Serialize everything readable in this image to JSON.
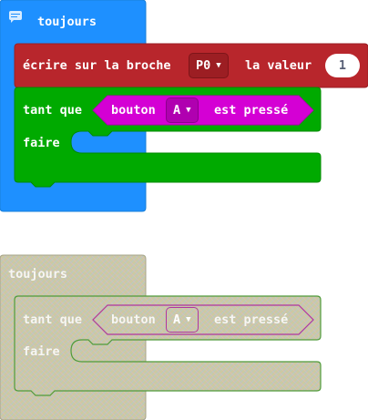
{
  "active_blocks": {
    "forever_label": "toujours",
    "write_pin": {
      "label": "écrire sur la broche",
      "pin": "P0",
      "value_label": "la valeur",
      "value": "1"
    },
    "while": {
      "label": "tant que",
      "condition": {
        "label": "bouton",
        "button": "A",
        "suffix": "est pressé"
      },
      "do_label": "faire"
    }
  },
  "disabled_blocks": {
    "forever_label": "toujours",
    "while": {
      "label": "tant que",
      "condition": {
        "label": "bouton",
        "button": "A",
        "suffix": "est pressé"
      },
      "do_label": "faire"
    }
  },
  "colors": {
    "events_blue": "#1e90ff",
    "pins_red": "#b8262c",
    "loops_green": "#00aa00",
    "input_magenta": "#d400d4",
    "disabled_fill": "#cbc9a2",
    "disabled_stroke_green": "#4f9b3a",
    "disabled_stroke_purple": "#b0369f"
  },
  "icons": {
    "forever_icon": "speech-bubble-icon",
    "dropdown": "triangle-down-icon"
  }
}
